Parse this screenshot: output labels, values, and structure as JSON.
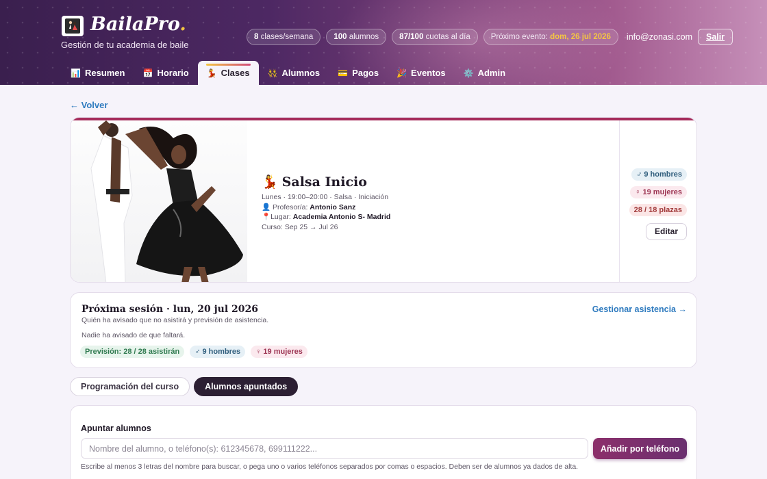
{
  "brand": {
    "name": "BailaPro",
    "dot": ".",
    "tagline": "Gestión de tu academia de baile",
    "logo_icon": "dancer-logo"
  },
  "header": {
    "stats": [
      {
        "bold": "8",
        "text": " clases/semana"
      },
      {
        "bold": "100",
        "text": " alumnos"
      },
      {
        "bold": "87/100",
        "text": " cuotas al día"
      }
    ],
    "event": {
      "label": "Próximo evento: ",
      "value": "dom, 26 jul 2026"
    },
    "email": "info@zonasi.com",
    "logout": "Salir"
  },
  "nav": {
    "tabs": [
      {
        "label": "Resumen",
        "icon": "📊"
      },
      {
        "label": "Horario",
        "icon": "📅"
      },
      {
        "label": "Clases",
        "icon": "💃"
      },
      {
        "label": "Alumnos",
        "icon": "👯"
      },
      {
        "label": "Pagos",
        "icon": "💳"
      },
      {
        "label": "Eventos",
        "icon": "🎉"
      },
      {
        "label": "Admin",
        "icon": "⚙️"
      }
    ],
    "active": "Clases"
  },
  "back_link": "← Volver",
  "class": {
    "icon": "💃",
    "title": "Salsa Inicio",
    "schedule": "Lunes · 19:00–20:00 · Salsa · Iniciación",
    "teacher_icon": "👤",
    "teacher_label": "Profesor/a: ",
    "teacher": "Antonio Sanz",
    "place_icon": "📍",
    "place_label": "Lugar: ",
    "place": "Academia Antonio S- Madrid",
    "course": "Curso: Sep 25 → Jul 26",
    "men": "♂ 9 hombres",
    "women": "♀ 19 mujeres",
    "plazas": "28 / 18 plazas",
    "edit": "Editar",
    "accent_color": "#a52a5a"
  },
  "session": {
    "title": "Próxima sesión · lun, 20 jul 2026",
    "subtitle": "Quién ha avisado que no asistirá y previsión de asistencia.",
    "none": "Nadie ha avisado de que faltará.",
    "manage": "Gestionar asistencia →",
    "forecast": "Previsión: 28 / 28 asistirán",
    "men": "♂ 9 hombres",
    "women": "♀ 19 mujeres"
  },
  "segments": {
    "program": "Programación del curso",
    "students": "Alumnos apuntados",
    "active": "Alumnos apuntados"
  },
  "enroll": {
    "title": "Apuntar alumnos",
    "placeholder": "Nombre del alumno, o teléfono(s): 612345678, 699111222...",
    "value": "",
    "button": "Añadir por teléfono",
    "help": "Escribe al menos 3 letras del nombre para buscar, o pega uno o varios teléfonos separados por comas o espacios. Deben ser de alumnos ya dados de alta."
  }
}
